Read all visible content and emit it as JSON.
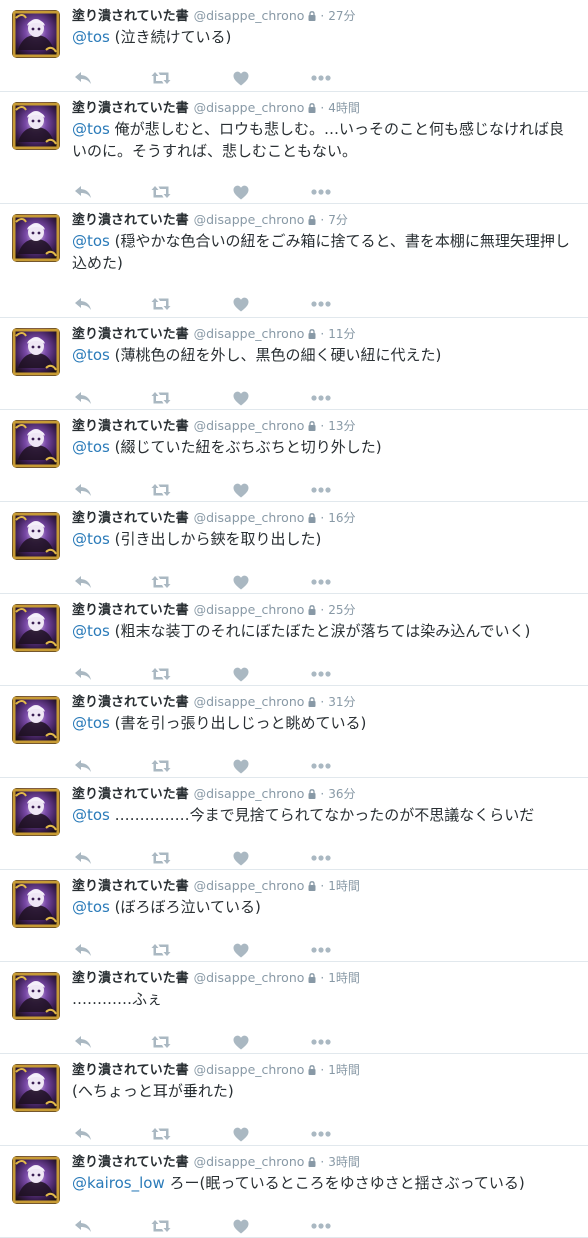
{
  "icons": {
    "reply": "reply-icon",
    "retweet": "retweet-icon",
    "like": "heart-icon",
    "more": "more-icon",
    "lock": "lock-icon"
  },
  "colors": {
    "mention": "#2b7bb9",
    "meta": "#8899a6",
    "action_icon": "#aab8c2",
    "divider": "#e1e8ed"
  },
  "tweets": [
    {
      "name": "塗り潰されていた書",
      "handle": "@disappe_chrono",
      "time": "27分",
      "mention": "@tos",
      "text": " (泣き続けている)"
    },
    {
      "name": "塗り潰されていた書",
      "handle": "@disappe_chrono",
      "time": "4時間",
      "mention": "@tos",
      "text": " 俺が悲しむと、ロウも悲しむ。…いっそのこと何も感じなければ良いのに。そうすれば、悲しむこともない。"
    },
    {
      "name": "塗り潰されていた書",
      "handle": "@disappe_chrono",
      "time": "7分",
      "mention": "@tos",
      "text": " (穏やかな色合いの紐をごみ箱に捨てると、書を本棚に無理矢理押し込めた)"
    },
    {
      "name": "塗り潰されていた書",
      "handle": "@disappe_chrono",
      "time": "11分",
      "mention": "@tos",
      "text": " (薄桃色の紐を外し、黒色の細く硬い紐に代えた)"
    },
    {
      "name": "塗り潰されていた書",
      "handle": "@disappe_chrono",
      "time": "13分",
      "mention": "@tos",
      "text": " (綴じていた紐をぶちぶちと切り外した)"
    },
    {
      "name": "塗り潰されていた書",
      "handle": "@disappe_chrono",
      "time": "16分",
      "mention": "@tos",
      "text": " (引き出しから鋏を取り出した)"
    },
    {
      "name": "塗り潰されていた書",
      "handle": "@disappe_chrono",
      "time": "25分",
      "mention": "@tos",
      "text": " (粗末な装丁のそれにぼたぼたと涙が落ちては染み込んでいく)"
    },
    {
      "name": "塗り潰されていた書",
      "handle": "@disappe_chrono",
      "time": "31分",
      "mention": "@tos",
      "text": " (書を引っ張り出しじっと眺めている)"
    },
    {
      "name": "塗り潰されていた書",
      "handle": "@disappe_chrono",
      "time": "36分",
      "mention": "@tos",
      "text": " ……………今まで見捨てられてなかったのが不思議なくらいだ"
    },
    {
      "name": "塗り潰されていた書",
      "handle": "@disappe_chrono",
      "time": "1時間",
      "mention": "@tos",
      "text": " (ぼろぼろ泣いている)"
    },
    {
      "name": "塗り潰されていた書",
      "handle": "@disappe_chrono",
      "time": "1時間",
      "mention": "",
      "text": "…………ふぇ"
    },
    {
      "name": "塗り潰されていた書",
      "handle": "@disappe_chrono",
      "time": "1時間",
      "mention": "",
      "text": "(へちょっと耳が垂れた)"
    },
    {
      "name": "塗り潰されていた書",
      "handle": "@disappe_chrono",
      "time": "3時間",
      "mention": "@kairos_low",
      "text": " ろー(眠っているところをゆさゆさと揺さぶっている)"
    }
  ]
}
